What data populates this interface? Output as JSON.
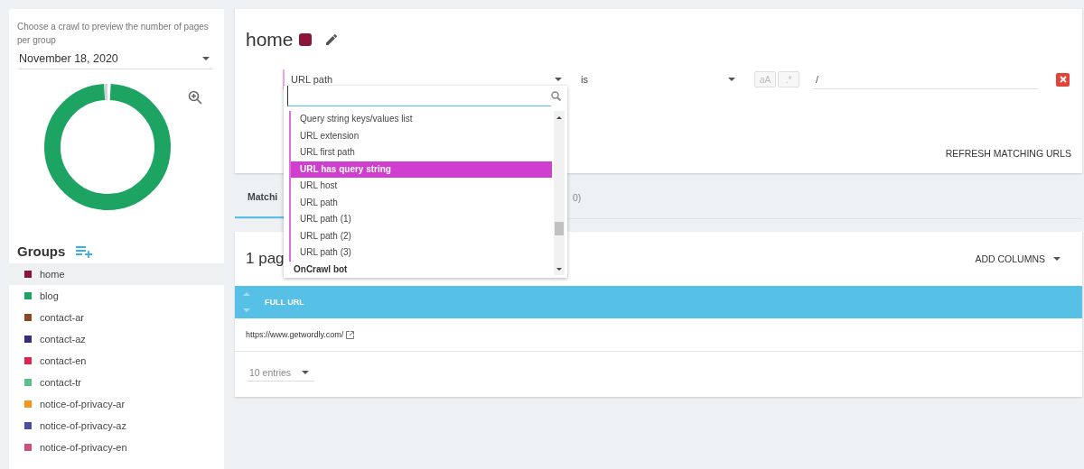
{
  "sidebar": {
    "hint": "Choose a crawl to preview the number of pages per group",
    "crawl_select": {
      "value": "November 18, 2020"
    },
    "groups_title": "Groups",
    "groups": [
      {
        "label": "home",
        "color": "#8b1538",
        "selected": true
      },
      {
        "label": "blog",
        "color": "#1da462",
        "selected": false
      },
      {
        "label": "contact-ar",
        "color": "#8b4a24",
        "selected": false
      },
      {
        "label": "contact-az",
        "color": "#3a2a7e",
        "selected": false
      },
      {
        "label": "contact-en",
        "color": "#e0234e",
        "selected": false
      },
      {
        "label": "contact-tr",
        "color": "#5cc08a",
        "selected": false
      },
      {
        "label": "notice-of-privacy-ar",
        "color": "#f7931e",
        "selected": false
      },
      {
        "label": "notice-of-privacy-az",
        "color": "#4a4fa0",
        "selected": false
      },
      {
        "label": "notice-of-privacy-en",
        "color": "#d0507c",
        "selected": false
      }
    ]
  },
  "group_editor": {
    "title": "home",
    "color": "#8b1538",
    "filter": {
      "field": "URL path",
      "operator": "is",
      "case_button": "aA",
      "regex_button": ".*",
      "value": "/"
    },
    "refresh_button": "REFRESH MATCHING URLS"
  },
  "tabs": [
    {
      "label": "Matchi",
      "selected": true
    },
    {
      "label": "0)",
      "selected": false
    }
  ],
  "results": {
    "heading": "1 pag",
    "add_columns": "ADD COLUMNS",
    "columns": [
      "FULL URL"
    ],
    "rows": [
      [
        "https://www.getwordly.com/"
      ]
    ],
    "page_size": "10 entries"
  },
  "field_dropdown": {
    "options": [
      {
        "kind": "option",
        "label": "Query string keys/values list",
        "selected": false
      },
      {
        "kind": "option",
        "label": "URL extension",
        "selected": false
      },
      {
        "kind": "option",
        "label": "URL first path",
        "selected": false
      },
      {
        "kind": "option",
        "label": "URL has query string",
        "selected": true
      },
      {
        "kind": "option",
        "label": "URL host",
        "selected": false
      },
      {
        "kind": "option",
        "label": "URL path",
        "selected": false
      },
      {
        "kind": "option",
        "label": "URL path (1)",
        "selected": false
      },
      {
        "kind": "option",
        "label": "URL path (2)",
        "selected": false
      },
      {
        "kind": "option",
        "label": "URL path (3)",
        "selected": false
      },
      {
        "kind": "group",
        "label": "OnCrawl bot"
      }
    ]
  }
}
